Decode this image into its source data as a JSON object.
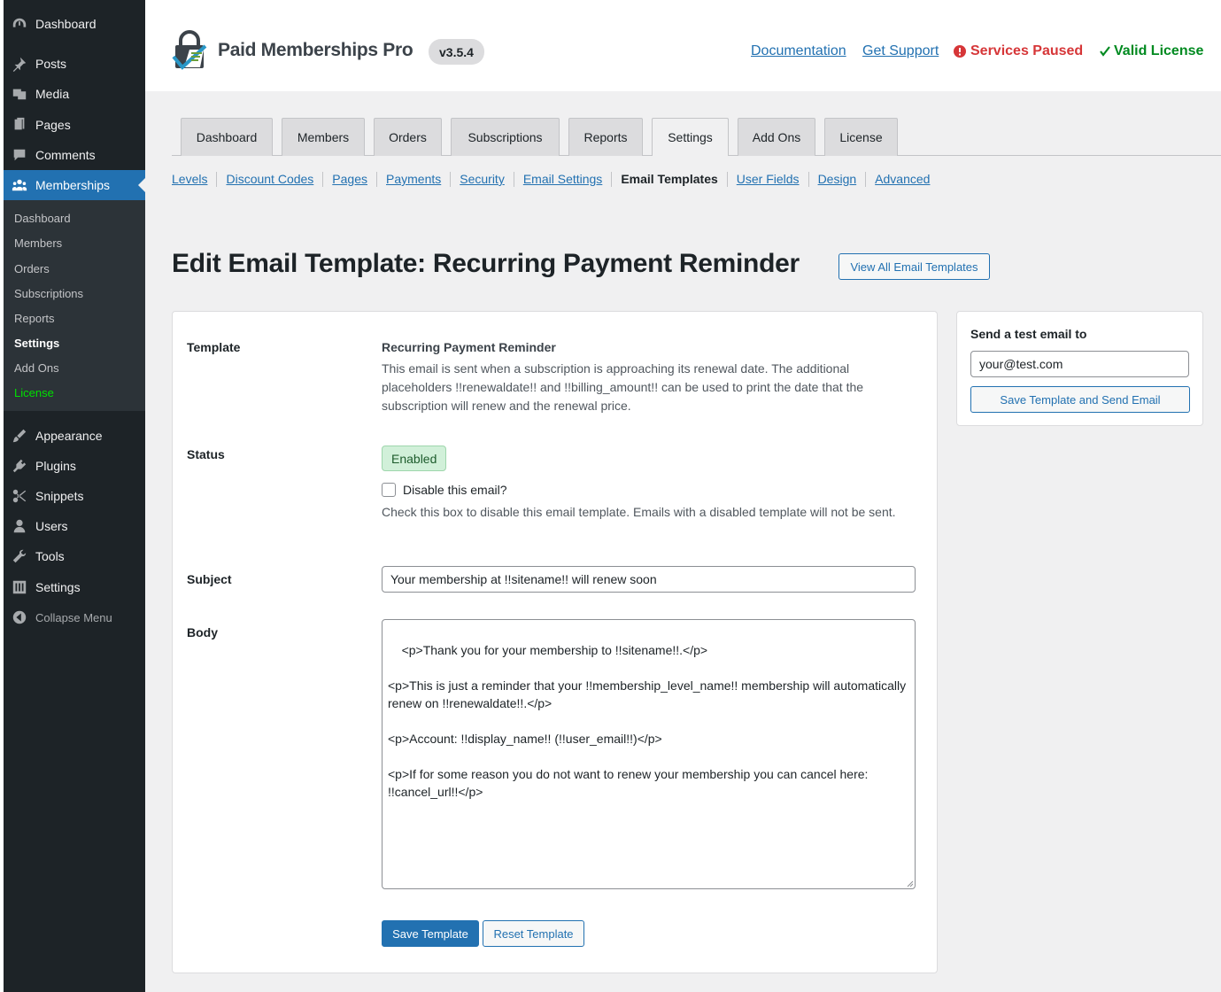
{
  "sidebar": {
    "top_items": [
      {
        "label": "Dashboard",
        "icon": "dashboard-icon"
      },
      {
        "label": "Posts",
        "icon": "pushpin-icon"
      },
      {
        "label": "Media",
        "icon": "media-icon"
      },
      {
        "label": "Pages",
        "icon": "pages-icon"
      },
      {
        "label": "Comments",
        "icon": "comment-icon"
      },
      {
        "label": "Memberships",
        "icon": "groups-icon"
      }
    ],
    "submenu": [
      "Dashboard",
      "Members",
      "Orders",
      "Subscriptions",
      "Reports",
      "Settings",
      "Add Ons",
      "License"
    ],
    "bottom_items": [
      {
        "label": "Appearance",
        "icon": "paintbrush-icon"
      },
      {
        "label": "Plugins",
        "icon": "plugin-icon"
      },
      {
        "label": "Snippets",
        "icon": "scissors-icon"
      },
      {
        "label": "Users",
        "icon": "user-icon"
      },
      {
        "label": "Tools",
        "icon": "wrench-icon"
      },
      {
        "label": "Settings",
        "icon": "settings-icon"
      }
    ],
    "collapse_label": "Collapse Menu"
  },
  "header": {
    "logo_text": "Paid Memberships Pro",
    "version": "v3.5.4",
    "documentation": "Documentation",
    "support": "Get Support",
    "services_status": "Services Paused",
    "license_status": "Valid License"
  },
  "tabs": [
    "Dashboard",
    "Members",
    "Orders",
    "Subscriptions",
    "Reports",
    "Settings",
    "Add Ons",
    "License"
  ],
  "subnav": [
    "Levels",
    "Discount Codes",
    "Pages",
    "Payments",
    "Security",
    "Email Settings",
    "Email Templates",
    "User Fields",
    "Design",
    "Advanced"
  ],
  "page": {
    "title": "Edit Email Template: Recurring Payment Reminder",
    "view_all": "View All Email Templates"
  },
  "form": {
    "template_label": "Template",
    "template_name": "Recurring Payment Reminder",
    "template_desc": "This email is sent when a subscription is approaching its renewal date. The additional placeholders !!renewaldate!! and !!billing_amount!! can be used to print the date that the subscription will renew and the renewal price.",
    "status_label": "Status",
    "status_badge": "Enabled",
    "disable_label": "Disable this email?",
    "disable_help": "Check this box to disable this email template. Emails with a disabled template will not be sent.",
    "subject_label": "Subject",
    "subject_value": "Your membership at !!sitename!! will renew soon",
    "body_label": "Body",
    "body_value": "<p>Thank you for your membership to !!sitename!!.</p>\n\n<p>This is just a reminder that your !!membership_level_name!! membership will automatically renew on !!renewaldate!!.</p>\n\n<p>Account: !!display_name!! (!!user_email!!)</p>\n\n<p>If for some reason you do not want to renew your membership you can cancel here: !!cancel_url!!</p>",
    "save_button": "Save Template",
    "reset_button": "Reset Template"
  },
  "test_email": {
    "title": "Send a test email to",
    "value": "your@test.com",
    "button": "Save Template and Send Email"
  },
  "colors": {
    "accent": "#2271b1",
    "sidebar": "#1d2327",
    "error": "#d63638",
    "success": "#008a20"
  }
}
